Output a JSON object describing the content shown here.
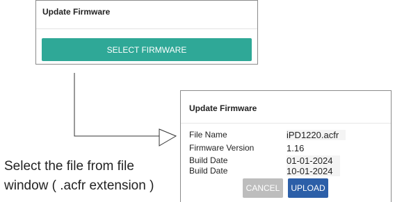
{
  "select_panel": {
    "title": "Update Firmware",
    "select_button": "SELECT FIRMWARE"
  },
  "upload_dialog": {
    "title": "Update Firmware",
    "fields": [
      {
        "label": "File Name",
        "value": "iPD1220.acfr"
      },
      {
        "label": "Firmware Version",
        "value": "1.16"
      },
      {
        "label": "Build Date",
        "value": "01-01-2024"
      },
      {
        "label": "Build Date",
        "value": "10-01-2024"
      }
    ],
    "cancel_button": "CANCEL",
    "upload_button": "UPLOAD"
  },
  "caption": {
    "line1": "Select the file from file",
    "line2": "window ( .acfr extension )"
  },
  "colors": {
    "select_button": "#2fa897",
    "upload_button": "#2c5fa8",
    "cancel_button": "#bdbdbd"
  }
}
